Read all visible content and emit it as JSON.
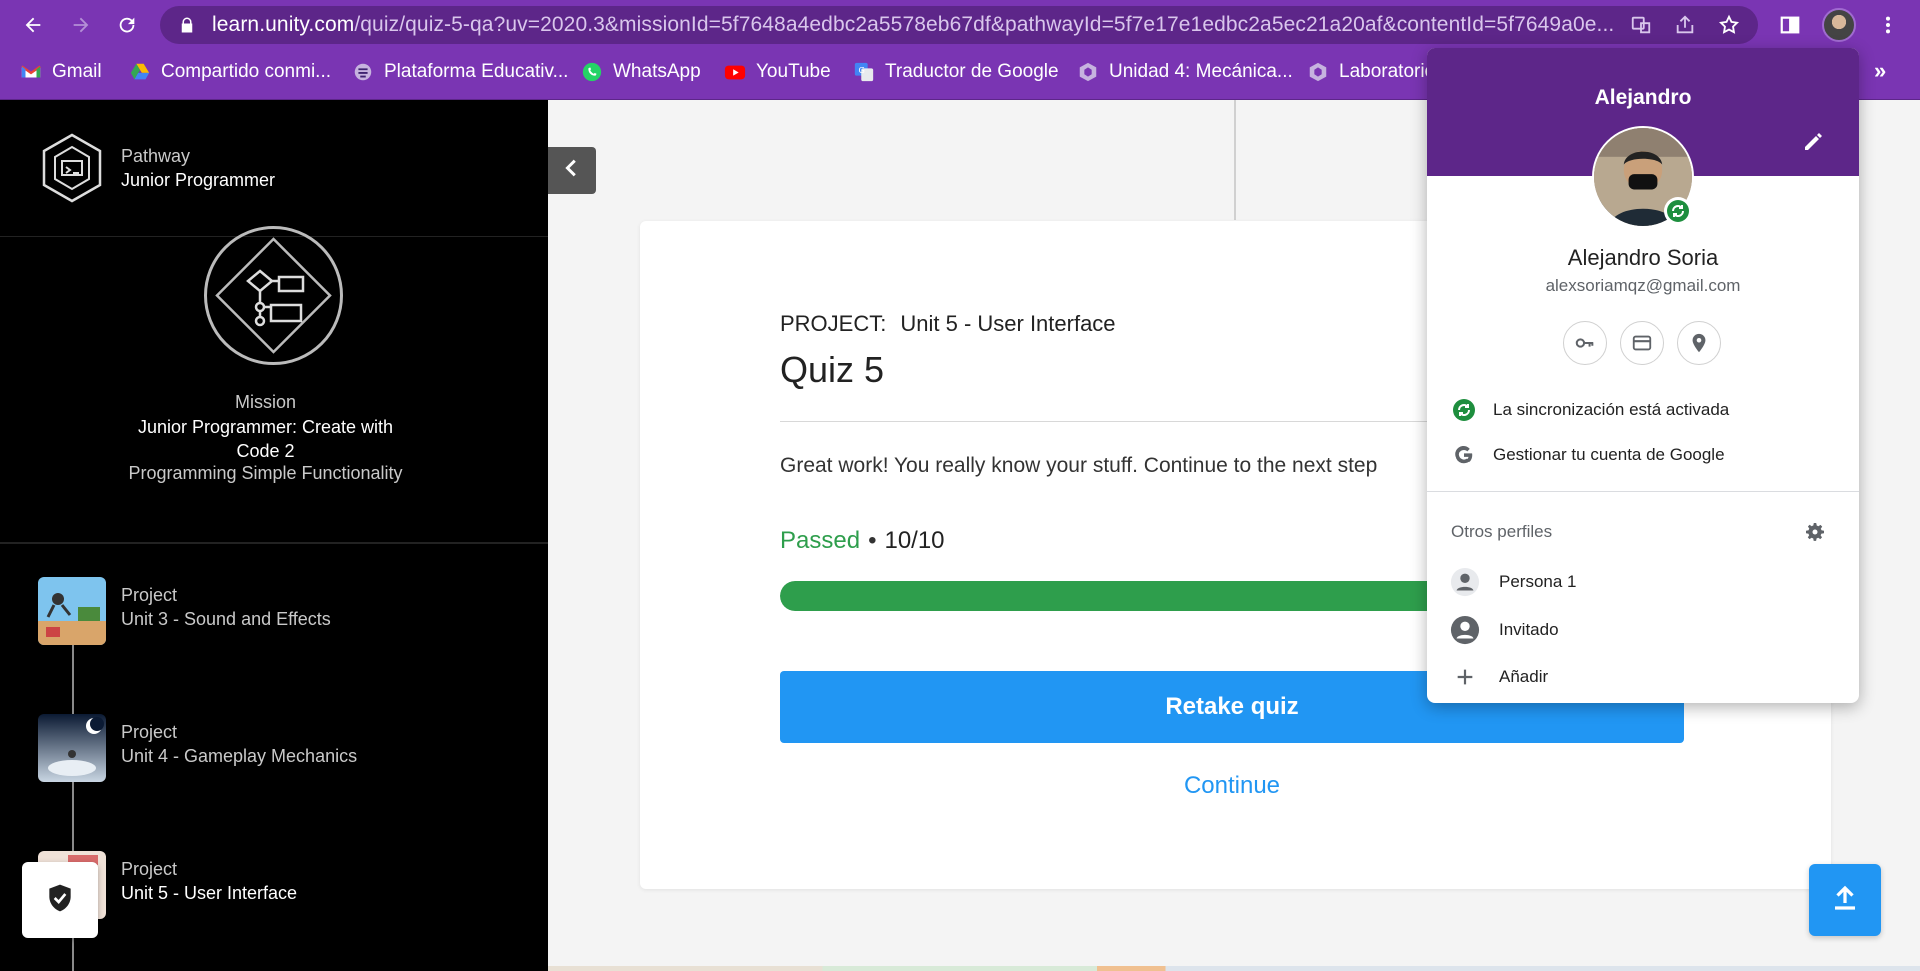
{
  "browser": {
    "url_host": "learn.unity.com",
    "url_rest": "/quiz/quiz-5-qa?uv=2020.3&missionId=5f7648a4edbc2a5578eb67df&pathwayId=5f7e17e1edbc2a5ec21a20af&contentId=5f7649a0e...",
    "accent": "#7a35b3",
    "bookmarks": [
      {
        "label": "Gmail",
        "icon": "gmail-icon"
      },
      {
        "label": "Compartido conmi...",
        "icon": "google-drive-icon"
      },
      {
        "label": "Plataforma Educativ...",
        "icon": "platform-icon"
      },
      {
        "label": "WhatsApp",
        "icon": "whatsapp-icon"
      },
      {
        "label": "YouTube",
        "icon": "youtube-icon"
      },
      {
        "label": "Traductor de Google",
        "icon": "translate-icon"
      },
      {
        "label": "Unidad 4: Mecánica...",
        "icon": "unity-icon"
      },
      {
        "label": "Laboratorio",
        "icon": "unity-icon"
      }
    ],
    "bookmarks_more": "»"
  },
  "sidebar": {
    "pathway_caption": "Pathway",
    "pathway_title": "Junior Programmer",
    "mission_caption": "Mission",
    "mission_title": "Junior Programmer: Create with Code 2",
    "mission_subtitle": "Programming Simple Functionality",
    "projects": [
      {
        "caption": "Project",
        "name": "Unit 3 - Sound and Effects",
        "active": false
      },
      {
        "caption": "Project",
        "name": "Unit 4 - Gameplay Mechanics",
        "active": false
      },
      {
        "caption": "Project",
        "name": "Unit 5 - User Interface",
        "active": true
      }
    ]
  },
  "quiz": {
    "project_label": "PROJECT:",
    "project_name": "Unit 5 - User Interface",
    "title": "Quiz 5",
    "message": "Great work! You really know your stuff. Continue to the next step",
    "status": "Passed",
    "separator": "•",
    "score": "10/10",
    "progress_fraction": 1.0,
    "retake_label": "Retake quiz",
    "continue_label": "Continue",
    "colors": {
      "passed": "#2e9e4c",
      "primary": "#2196f3"
    }
  },
  "profile": {
    "header_name": "Alejandro",
    "full_name": "Alejandro Soria",
    "email": "alexsoriamqz@gmail.com",
    "sync_label": "La sincronización está activada",
    "manage_label": "Gestionar tu cuenta de Google",
    "others_label": "Otros perfiles",
    "others": [
      {
        "label": "Persona 1",
        "icon": "person-icon"
      },
      {
        "label": "Invitado",
        "icon": "guest-icon"
      },
      {
        "label": "Añadir",
        "icon": "plus-icon"
      }
    ]
  }
}
